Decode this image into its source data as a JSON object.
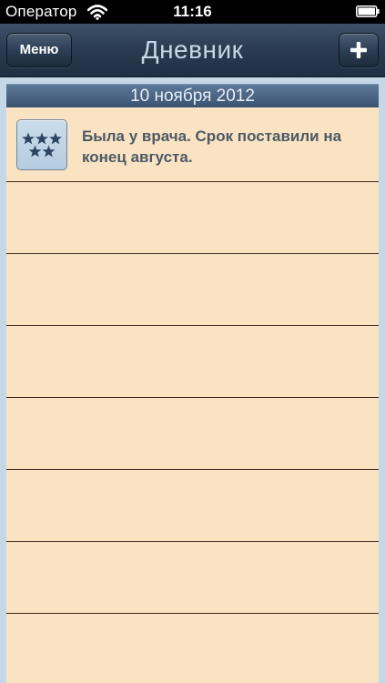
{
  "status_bar": {
    "carrier": "Оператор",
    "time": "11:16",
    "wifi_icon": "wifi-icon",
    "battery_icon": "battery-icon"
  },
  "nav": {
    "title": "Дневник",
    "menu_label": "Меню",
    "add_icon": "plus-icon"
  },
  "diary": {
    "date_header": "10 ноября 2012",
    "entries": [
      {
        "icon": "rating-stars-icon",
        "text": "Была у врача. Срок поставили на конец августа."
      }
    ]
  },
  "colors": {
    "nav_background": "#2b3c52",
    "title_text": "#c7d7e8",
    "section_header": "#4a6482",
    "paper": "#f9e3c2",
    "rule_line": "#3a2a1c",
    "entry_text": "#4e5966",
    "star": "#2c4560"
  }
}
